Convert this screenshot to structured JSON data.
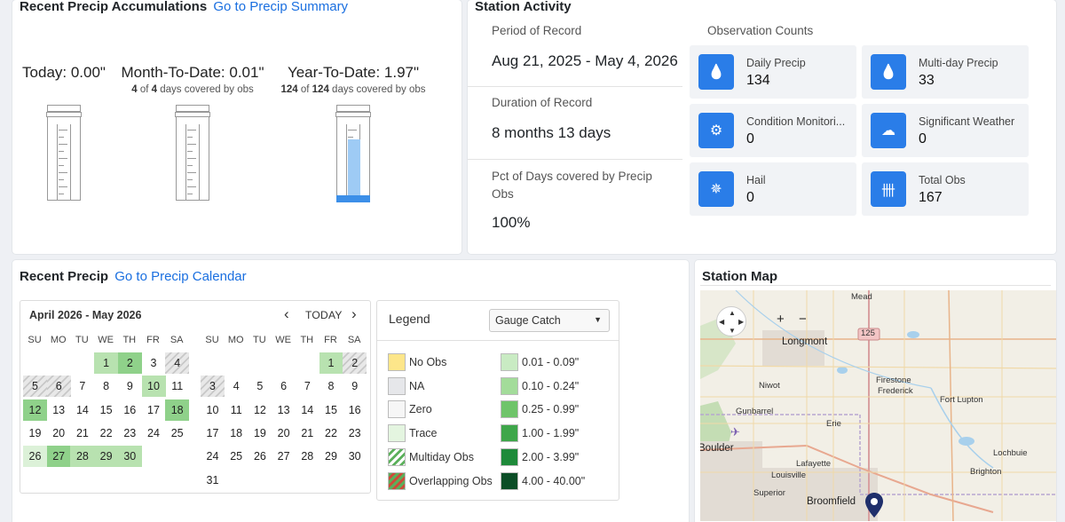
{
  "accum": {
    "title": "Recent Precip Accumulations",
    "link": "Go to Precip Summary",
    "today": {
      "label": "Today: 0.00\"",
      "fill": 0.0
    },
    "mtd": {
      "label": "Month-To-Date: 0.01\"",
      "covered": "4",
      "total": "4",
      "suffix": "days covered by obs",
      "of": "of",
      "fill": 0.0
    },
    "ytd": {
      "label": "Year-To-Date: 1.97\"",
      "covered": "124",
      "total": "124",
      "suffix": "days covered by obs",
      "of": "of",
      "fill": 0.82
    }
  },
  "activity": {
    "title": "Station Activity",
    "period_label": "Period of Record",
    "period_value": "Aug 21, 2025 - May 4, 2026",
    "duration_label": "Duration of Record",
    "duration_value": "8 months 13 days",
    "pct_label": "Pct of Days covered by Precip Obs",
    "pct_value": "100%",
    "obs_title": "Observation Counts",
    "tiles": [
      {
        "name": "Daily Precip",
        "count": "134",
        "icon": "drop-icon"
      },
      {
        "name": "Multi-day Precip",
        "count": "33",
        "icon": "drops-icon"
      },
      {
        "name": "Condition Monitori...",
        "count": "0",
        "icon": "gears-icon"
      },
      {
        "name": "Significant Weather",
        "count": "0",
        "icon": "storm-cloud-icon"
      },
      {
        "name": "Hail",
        "count": "0",
        "icon": "hail-icon"
      },
      {
        "name": "Total Obs",
        "count": "167",
        "icon": "tally-icon"
      }
    ]
  },
  "calendar": {
    "title": "Recent Precip",
    "link": "Go to Precip Calendar",
    "range": "April 2026 - May 2026",
    "today_label": "TODAY",
    "prev": "‹",
    "next": "›",
    "dow": [
      "SU",
      "MO",
      "TU",
      "WE",
      "TH",
      "FR",
      "SA"
    ],
    "april": [
      {
        "d": "1",
        "s": "lvl1"
      },
      {
        "d": "2",
        "s": "lvl2"
      },
      {
        "d": "3",
        "s": ""
      },
      {
        "d": "4",
        "s": "multi"
      },
      {
        "d": "5",
        "s": "multi"
      },
      {
        "d": "6",
        "s": "multi"
      },
      {
        "d": "7",
        "s": ""
      },
      {
        "d": "8",
        "s": ""
      },
      {
        "d": "9",
        "s": ""
      },
      {
        "d": "10",
        "s": "lvl1"
      },
      {
        "d": "11",
        "s": ""
      },
      {
        "d": "12",
        "s": "lvl2"
      },
      {
        "d": "13",
        "s": ""
      },
      {
        "d": "14",
        "s": ""
      },
      {
        "d": "15",
        "s": ""
      },
      {
        "d": "16",
        "s": ""
      },
      {
        "d": "17",
        "s": ""
      },
      {
        "d": "18",
        "s": "lvl2"
      },
      {
        "d": "19",
        "s": ""
      },
      {
        "d": "20",
        "s": ""
      },
      {
        "d": "21",
        "s": ""
      },
      {
        "d": "22",
        "s": ""
      },
      {
        "d": "23",
        "s": ""
      },
      {
        "d": "24",
        "s": ""
      },
      {
        "d": "25",
        "s": ""
      },
      {
        "d": "26",
        "s": "trace"
      },
      {
        "d": "27",
        "s": "lvl2"
      },
      {
        "d": "28",
        "s": "lvl1"
      },
      {
        "d": "29",
        "s": "lvl1"
      },
      {
        "d": "30",
        "s": "lvl1"
      }
    ],
    "april_start_col": 3,
    "may": [
      {
        "d": "1",
        "s": "lvl1"
      },
      {
        "d": "2",
        "s": "multi"
      },
      {
        "d": "3",
        "s": "multi"
      },
      {
        "d": "4",
        "s": ""
      },
      {
        "d": "5",
        "s": ""
      },
      {
        "d": "6",
        "s": ""
      },
      {
        "d": "7",
        "s": ""
      },
      {
        "d": "8",
        "s": ""
      },
      {
        "d": "9",
        "s": ""
      },
      {
        "d": "10",
        "s": ""
      },
      {
        "d": "11",
        "s": ""
      },
      {
        "d": "12",
        "s": ""
      },
      {
        "d": "13",
        "s": ""
      },
      {
        "d": "14",
        "s": ""
      },
      {
        "d": "15",
        "s": ""
      },
      {
        "d": "16",
        "s": ""
      },
      {
        "d": "17",
        "s": ""
      },
      {
        "d": "18",
        "s": ""
      },
      {
        "d": "19",
        "s": ""
      },
      {
        "d": "20",
        "s": ""
      },
      {
        "d": "21",
        "s": ""
      },
      {
        "d": "22",
        "s": ""
      },
      {
        "d": "23",
        "s": ""
      },
      {
        "d": "24",
        "s": ""
      },
      {
        "d": "25",
        "s": ""
      },
      {
        "d": "26",
        "s": ""
      },
      {
        "d": "27",
        "s": ""
      },
      {
        "d": "28",
        "s": ""
      },
      {
        "d": "29",
        "s": ""
      },
      {
        "d": "30",
        "s": ""
      },
      {
        "d": "31",
        "s": ""
      }
    ],
    "may_start_col": 5
  },
  "legend": {
    "title": "Legend",
    "select_value": "Gauge Catch",
    "left": [
      {
        "label": "No Obs",
        "color": "#fde68a"
      },
      {
        "label": "NA",
        "color": "#e6e7ea"
      },
      {
        "label": "Zero",
        "color": "#f6f6f6"
      },
      {
        "label": "Trace",
        "color": "#e4f5e0"
      },
      {
        "label": "Multiday Obs",
        "color": "stripe-green"
      },
      {
        "label": "Overlapping Obs",
        "color": "stripe-red"
      }
    ],
    "right": [
      {
        "label": "0.01 - 0.09\"",
        "color": "#c9ebc3"
      },
      {
        "label": "0.10 - 0.24\"",
        "color": "#a3dc9a"
      },
      {
        "label": "0.25 - 0.99\"",
        "color": "#6fc46a"
      },
      {
        "label": "1.00 - 1.99\"",
        "color": "#3ea64a"
      },
      {
        "label": "2.00 - 3.99\"",
        "color": "#1e8a3a"
      },
      {
        "label": "4.00 - 40.00\"",
        "color": "#0b4d26"
      }
    ]
  },
  "map": {
    "title": "Station Map",
    "zoom_in": "+",
    "zoom_out": "−",
    "labels": [
      "Mead",
      "Longmont",
      "Niwot",
      "Firestone",
      "Frederick",
      "Fort Lupton",
      "Gunbarrel",
      "Erie",
      "Boulder",
      "Lafayette",
      "Louisville",
      "Lochbuie",
      "Brighton",
      "Superior",
      "Broomfield",
      "125"
    ]
  }
}
